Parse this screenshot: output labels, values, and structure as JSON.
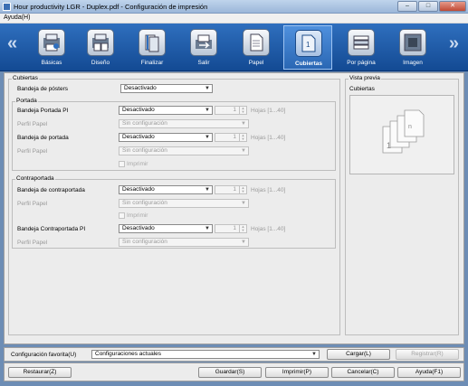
{
  "window": {
    "title": "Hour productivity LGR - Duplex.pdf - Configuración de impresión",
    "minimize": "–",
    "maximize": "□",
    "close": "✕"
  },
  "menu": {
    "help": "Ayuda(H)"
  },
  "toolbar": {
    "prev_arrow": "«",
    "next_arrow": "»",
    "tabs": [
      {
        "label": "Básicas"
      },
      {
        "label": "Diseño"
      },
      {
        "label": "Finalizar"
      },
      {
        "label": "Salir"
      },
      {
        "label": "Papel"
      },
      {
        "label": "Cubiertas",
        "active": true
      },
      {
        "label": "Por página"
      },
      {
        "label": "Imagen"
      }
    ]
  },
  "cubiertas": {
    "group_title": "Cubiertas",
    "poster_tray_label": "Bandeja de pósters",
    "poster_tray_value": "Desactivado",
    "portada": {
      "title": "Portada",
      "pi_tray_label": "Bandeja Portada PI",
      "pi_tray_value": "Desactivado",
      "pi_sheets": "1",
      "pi_sheets_range": "Hojas [1...40]",
      "pi_profile_label": "Perfil Papel",
      "pi_profile_value": "Sin configuración",
      "tray_label": "Bandeja de portada",
      "tray_value": "Desactivado",
      "sheets": "1",
      "sheets_range": "Hojas [1...40]",
      "profile_label": "Perfil Papel",
      "profile_value": "Sin configuración",
      "print_label": "Imprimir"
    },
    "contraportada": {
      "title": "Contraportada",
      "tray_label": "Bandeja de contraportada",
      "tray_value": "Desactivado",
      "sheets": "1",
      "sheets_range": "Hojas [1...40]",
      "profile_label": "Perfil Papel",
      "profile_value": "Sin configuración",
      "print_label": "Imprimir",
      "pi_tray_label": "Bandeja Contraportada PI",
      "pi_tray_value": "Desactivado",
      "pi_sheets": "1",
      "pi_sheets_range": "Hojas [1...40]",
      "pi_profile_label": "Perfil Papel",
      "pi_profile_value": "Sin configuración"
    }
  },
  "preview": {
    "title": "Vista previa",
    "subtitle": "Cubiertas"
  },
  "favorites": {
    "label": "Configuración favorita(U)",
    "value": "Configuraciones actuales",
    "load": "Cargar(L)",
    "register": "Registrar(R)"
  },
  "actions": {
    "restore": "Restaurar(Z)",
    "save": "Guardar(S)",
    "print": "Imprimir(P)",
    "cancel": "Cancelar(C)",
    "help": "Ayuda(F1)"
  }
}
